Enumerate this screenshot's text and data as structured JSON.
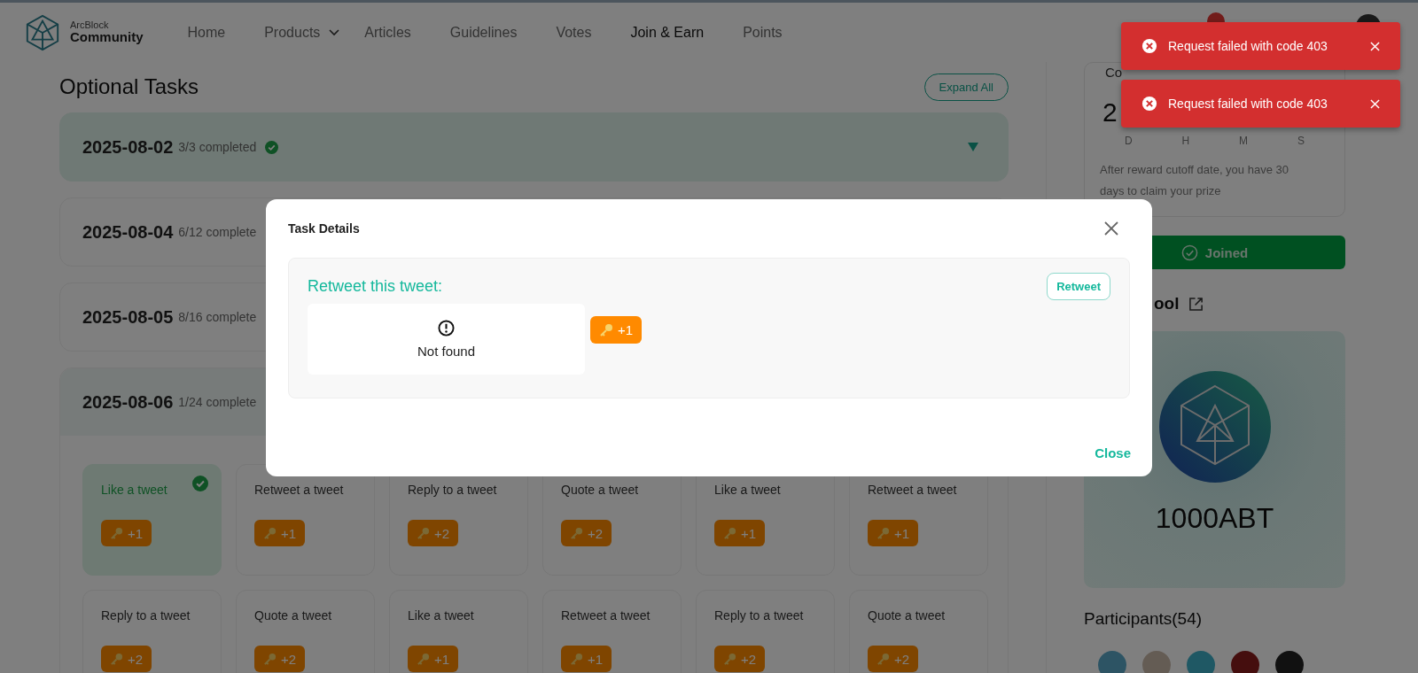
{
  "brand": {
    "line1": "ArcBlock",
    "line2": "Community"
  },
  "nav": [
    {
      "label": "Home",
      "selected": false,
      "dropdown": false
    },
    {
      "label": "Products",
      "selected": false,
      "dropdown": true
    },
    {
      "label": "Articles",
      "selected": false,
      "dropdown": false
    },
    {
      "label": "Guidelines",
      "selected": false,
      "dropdown": false
    },
    {
      "label": "Votes",
      "selected": false,
      "dropdown": false
    },
    {
      "label": "Join & Earn",
      "selected": true,
      "dropdown": false
    },
    {
      "label": "Points",
      "selected": false,
      "dropdown": false
    }
  ],
  "optional_tasks": {
    "title": "Optional Tasks",
    "expand_button": "Expand All",
    "sections": [
      {
        "date": "2025-08-02",
        "progress": "3/3 completed",
        "completed": true,
        "expanded": false
      },
      {
        "date": "2025-08-04",
        "progress": "6/12 complete",
        "completed": false
      },
      {
        "date": "2025-08-05",
        "progress": "8/16 complete",
        "completed": false
      },
      {
        "date": "2025-08-06",
        "progress": "1/24 complete",
        "completed": false,
        "expanded": true,
        "tasks": [
          {
            "label": "Like a tweet",
            "reward": "+1",
            "completed": true
          },
          {
            "label": "Retweet a tweet",
            "reward": "+1",
            "completed": false
          },
          {
            "label": "Reply to a tweet",
            "reward": "+2",
            "completed": false
          },
          {
            "label": "Quote a tweet",
            "reward": "+2",
            "completed": false
          },
          {
            "label": "Like a tweet",
            "reward": "+1",
            "completed": false
          },
          {
            "label": "Retweet a tweet",
            "reward": "+1",
            "completed": false
          },
          {
            "label": "Reply to a tweet",
            "reward": "+2",
            "completed": false
          },
          {
            "label": "Quote a tweet",
            "reward": "+2",
            "completed": false
          },
          {
            "label": "Like a tweet",
            "reward": "+1",
            "completed": false
          },
          {
            "label": "Retweet a tweet",
            "reward": "+1",
            "completed": false
          },
          {
            "label": "Reply to a tweet",
            "reward": "+2",
            "completed": false
          },
          {
            "label": "Quote a tweet",
            "reward": "+2",
            "completed": false
          }
        ]
      }
    ]
  },
  "countdown": {
    "title": "Co",
    "digits": "2",
    "units": [
      "D",
      "H",
      "M",
      "S"
    ],
    "note": "After reward cutoff date, you have 30 days to claim your prize"
  },
  "joined_button": "Joined",
  "pool": {
    "title": "ool",
    "amount": "1000ABT"
  },
  "participants": {
    "title": "Participants(54)"
  },
  "modal": {
    "title": "Task Details",
    "heading": "Retweet this tweet:",
    "action": "Retweet",
    "embed_message": "Not found",
    "reward": "+1",
    "close": "Close"
  },
  "toasts": [
    {
      "message": "Request failed with code 403"
    },
    {
      "message": "Request failed with code 403"
    }
  ]
}
